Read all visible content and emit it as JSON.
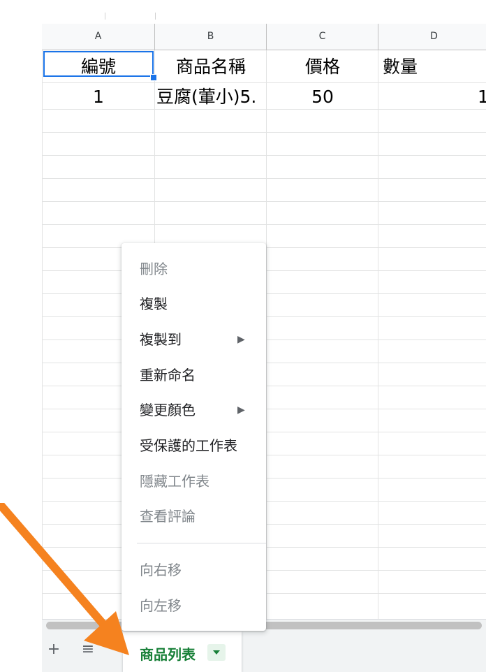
{
  "spreadsheet": {
    "columns": [
      "A",
      "B",
      "C",
      "D"
    ],
    "rows": [
      [
        "編號",
        "商品名稱",
        "價格",
        "數量"
      ],
      [
        "1",
        "豆腐(葷小)5.",
        "50",
        "1"
      ]
    ]
  },
  "context_menu": {
    "items": [
      {
        "label": "刪除",
        "disabled": true
      },
      {
        "label": "複製",
        "disabled": false
      },
      {
        "label": "複製到",
        "disabled": false,
        "submenu_arrow": "▶"
      },
      {
        "label": "重新命名",
        "disabled": false
      },
      {
        "label": "變更顏色",
        "disabled": false,
        "submenu_arrow": "▶"
      },
      {
        "label": "受保護的工作表",
        "disabled": false
      },
      {
        "label": "隱藏工作表",
        "disabled": true
      },
      {
        "label": "查看評論",
        "disabled": true
      },
      {
        "label": "向右移",
        "disabled": true
      },
      {
        "label": "向左移",
        "disabled": true
      }
    ]
  },
  "tab_bar": {
    "add_sheet_icon": "+",
    "all_sheets_icon": "≡",
    "active_sheet": "商品列表"
  },
  "colors": {
    "accent": "#1a73e8",
    "tab_green": "#188038",
    "annotation_arrow": "#f5821f"
  }
}
